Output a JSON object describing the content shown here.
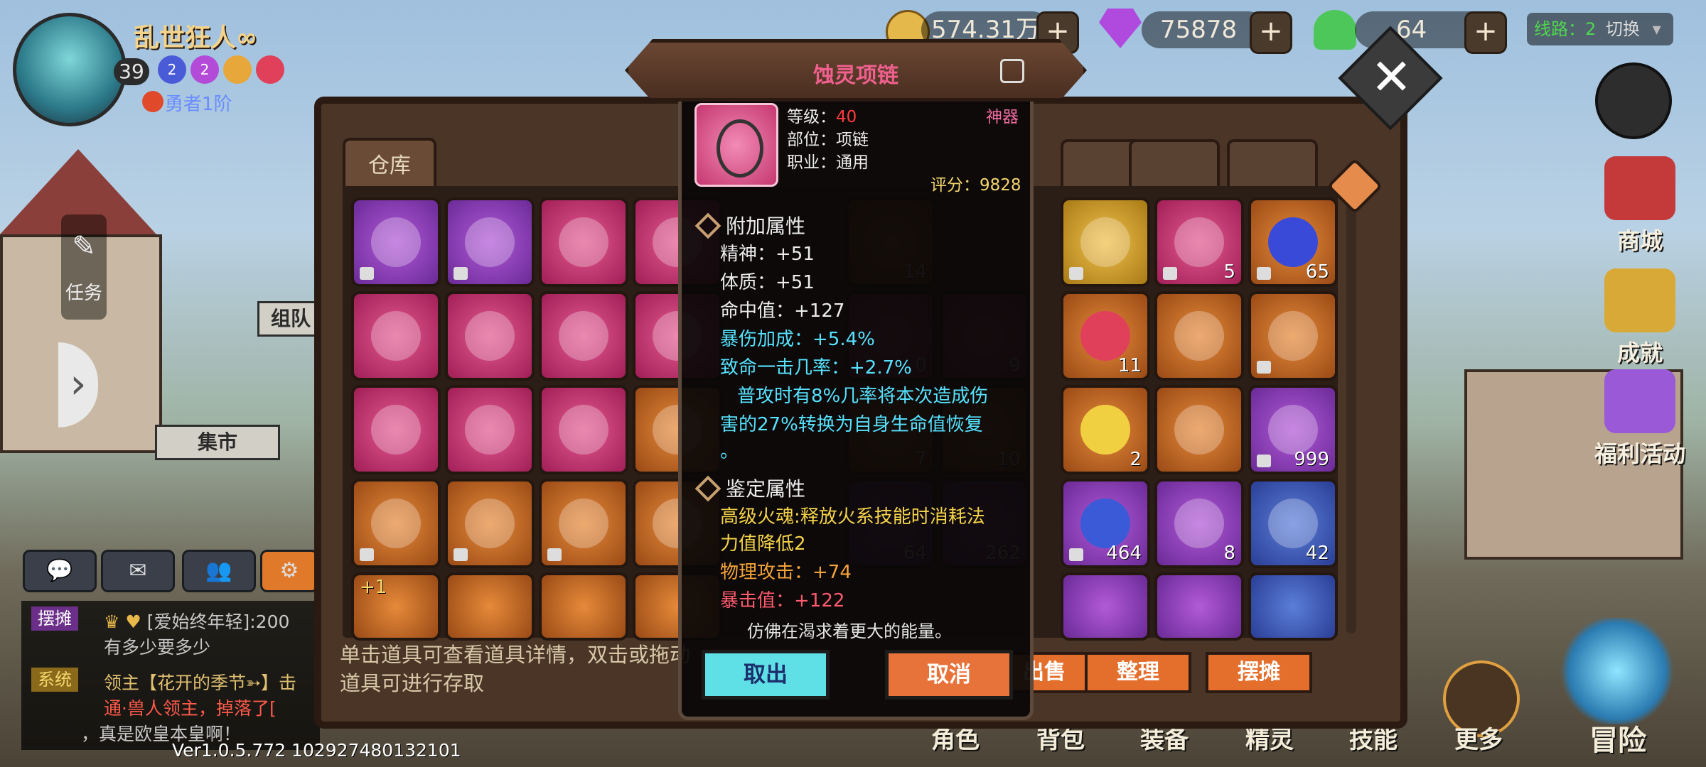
{
  "player": {
    "name": "乱世狂人∞",
    "level": "39",
    "badge1": "2",
    "badge2": "2",
    "rank": "勇者1阶"
  },
  "currency": {
    "gold": "574.31万",
    "gems": "75878",
    "hearts": "64"
  },
  "line": {
    "label": "线路：2",
    "switch": "切换"
  },
  "right_menu": {
    "shop": "商城",
    "achievement": "成就",
    "welfare": "福利活动"
  },
  "left": {
    "task": "任务",
    "team": "组队",
    "market": "集市"
  },
  "chat": {
    "tag1": "摆摊",
    "line1a": "[爱始终年轻]:200",
    "line1b": "有多少要多少",
    "tag2": "系统",
    "line2a": "领主【花开的季节➳】击",
    "line2b": "通·兽人领主，掉落了[",
    "line2c": "，真是欧皇本皇啊！"
  },
  "version": "Ver1.0.5.772 102927480132101",
  "bottom_nav": {
    "character": "角色",
    "backpack": "背包",
    "equipment": "装备",
    "spirit": "精灵",
    "skill": "技能",
    "more": "更多",
    "adventure": "冒险"
  },
  "warehouse": {
    "tab": "仓库",
    "hint": "单击道具可查看道具详情，双击或拖动道具可进行存取",
    "buttons": [
      "出售",
      "整理",
      "摆摊"
    ],
    "counts": {
      "c14": "14",
      "c5": "5",
      "c65": "65",
      "c0": "0",
      "c9": "9",
      "c11": "11",
      "c7": "7",
      "c10": "10",
      "c2": "2",
      "c999": "999",
      "c64": "64",
      "c262": "262",
      "c464": "464",
      "c8": "8",
      "c42": "42",
      "plus1": "+1"
    }
  },
  "tooltip": {
    "title": "蚀灵项链",
    "level_label": "等级：",
    "level": "40",
    "slot": "部位：项链",
    "job": "职业：通用",
    "quality": "神器",
    "score": "评分：9828",
    "extra_title": "附加属性",
    "extra": [
      "精神：+51",
      "体质：+51",
      "命中值：+127"
    ],
    "crit": [
      "暴伤加成：+5.4%",
      "致命一击几率：+2.7%"
    ],
    "passive": [
      "普攻时有8%几率将本次造成伤",
      "害的27%转换为自身生命值恢复",
      "。"
    ],
    "appraise_title": "鉴定属性",
    "appraise": [
      "高级火魂:释放火系技能时消耗法",
      "力值降低2"
    ],
    "phys": "物理攻击：+74",
    "critval": "暴击值：+122",
    "flavor": "仿佛在渴求着更大的能量。",
    "take": "取出",
    "cancel": "取消"
  },
  "colors": {
    "title_pink": "#f0608e",
    "level_red": "#ff3b3b",
    "quality_pink": "#f06ba0",
    "score_yellow": "#f5d76e",
    "crit_cyan": "#56e2ff",
    "appraise_yellow": "#f5d34a",
    "phys_orange": "#f5a33a",
    "critval_red": "#ff5a6e"
  }
}
